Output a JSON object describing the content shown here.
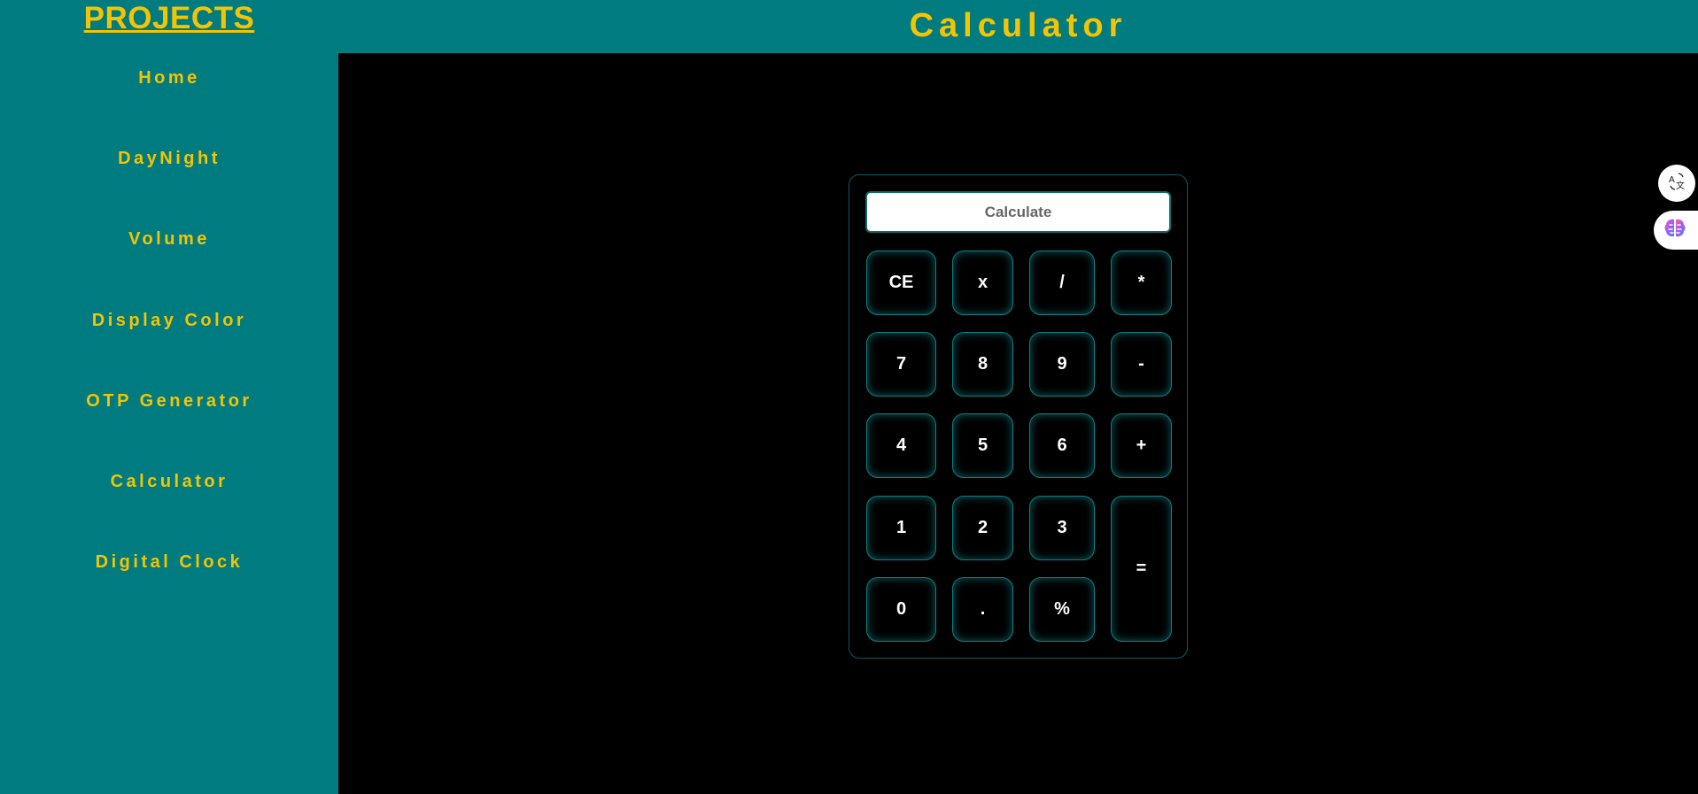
{
  "sidebar": {
    "brand": "PROJECTS",
    "items": [
      {
        "label": "Home"
      },
      {
        "label": "DayNight"
      },
      {
        "label": "Volume"
      },
      {
        "label": "Display Color"
      },
      {
        "label": "OTP Generator"
      },
      {
        "label": "Calculator"
      },
      {
        "label": "Digital Clock"
      }
    ]
  },
  "header": {
    "title": "Calculator"
  },
  "calculator": {
    "display_placeholder": "Calculate",
    "display_value": "",
    "keys": {
      "ce": "CE",
      "x": "x",
      "divide": "/",
      "multiply": "*",
      "seven": "7",
      "eight": "8",
      "nine": "9",
      "minus": "-",
      "four": "4",
      "five": "5",
      "six": "6",
      "plus": "+",
      "one": "1",
      "two": "2",
      "three": "3",
      "equals": "=",
      "zero": "0",
      "dot": ".",
      "percent": "%"
    }
  },
  "floating_widgets": {
    "translate_icon": "translate-icon",
    "brain_icon": "brain-icon"
  },
  "colors": {
    "teal": "#007c80",
    "gold": "#f5c400",
    "background": "#000000"
  }
}
